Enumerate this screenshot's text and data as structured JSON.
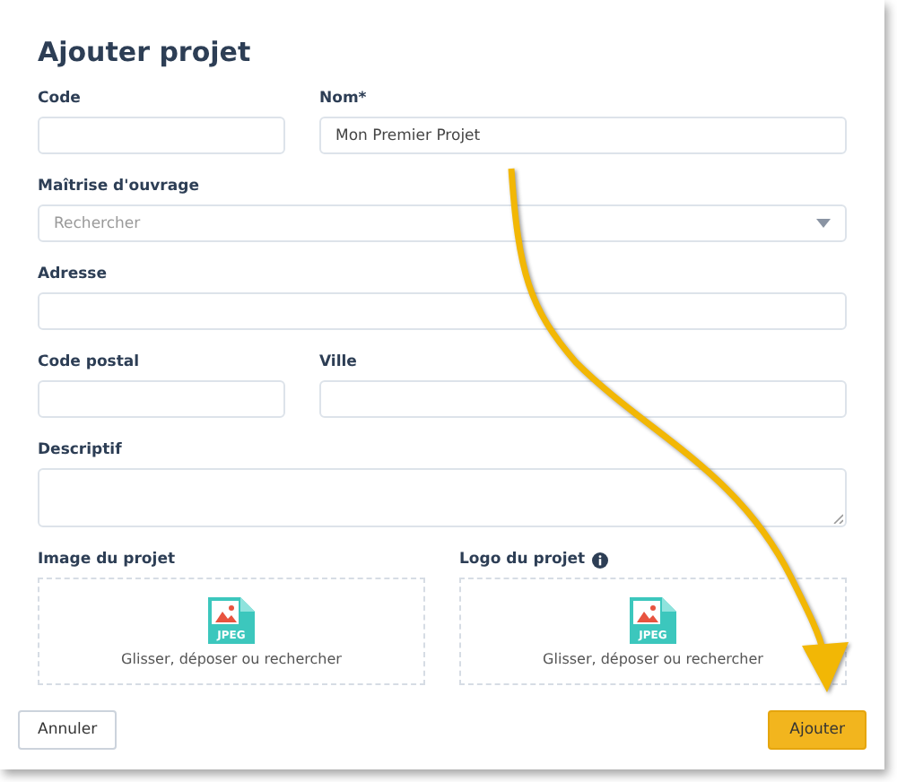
{
  "title": "Ajouter projet",
  "rows": [
    [
      {
        "kind": "input",
        "label": "Code"
      },
      {
        "kind": "input",
        "label": "Nom*",
        "value": "Mon Premier Projet"
      }
    ],
    [
      {
        "kind": "select",
        "label": "Maîtrise d'ouvrage",
        "placeholder": "Rechercher"
      }
    ],
    [
      {
        "kind": "input",
        "label": "Adresse"
      }
    ],
    [
      {
        "kind": "input",
        "label": "Code postal"
      },
      {
        "kind": "input",
        "label": "Ville"
      }
    ],
    [
      {
        "kind": "textarea",
        "label": "Descriptif"
      }
    ]
  ],
  "uploads": [
    {
      "label": "Image du projet",
      "info": false,
      "file_type": "JPEG",
      "hint": "Glisser, déposer ou rechercher"
    },
    {
      "label": "Logo du projet",
      "info": true,
      "file_type": "JPEG",
      "hint": "Glisser, déposer ou rechercher"
    }
  ],
  "buttons": [
    {
      "kind": "secondary",
      "label": "Annuler"
    },
    {
      "kind": "primary",
      "label": "Ajouter"
    }
  ]
}
